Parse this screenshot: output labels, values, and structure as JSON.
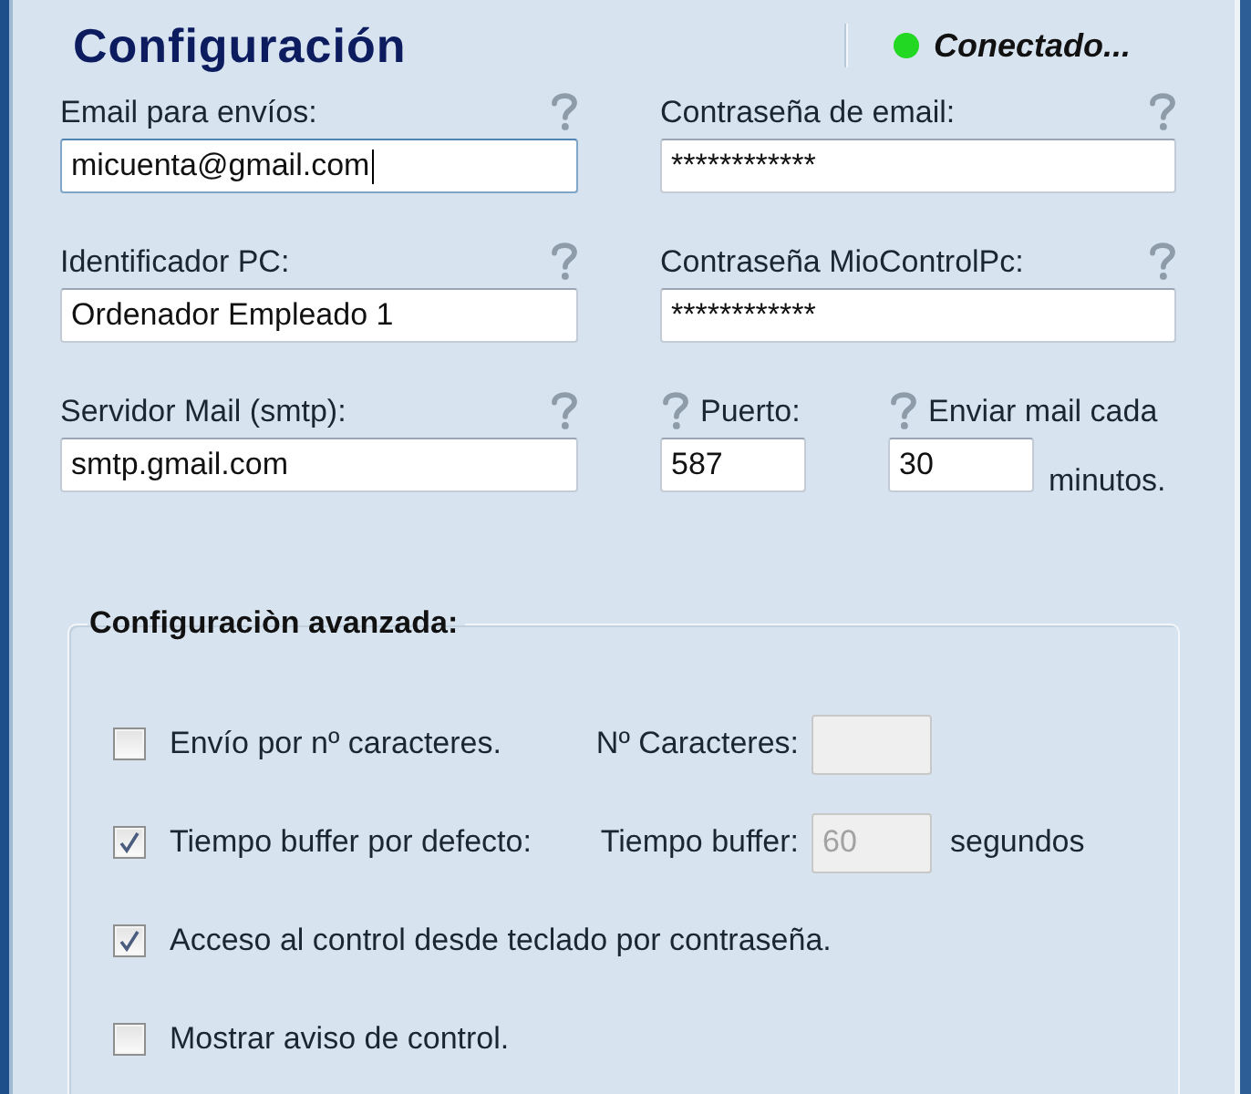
{
  "window": {
    "title": "Configuración"
  },
  "status": {
    "text": "Conectado...",
    "connected": true
  },
  "fields": [
    {
      "kind": "wide",
      "label": "Email para envíos:",
      "value": "micuenta@gmail.com",
      "focused": true
    },
    {
      "kind": "wide",
      "label": "Contraseña de email:",
      "value": "************",
      "focused": false
    },
    {
      "kind": "wide",
      "label": "Identificador PC:",
      "value": "Ordenador Empleado 1",
      "focused": false
    },
    {
      "kind": "wide",
      "label": "Contraseña MioControlPc:",
      "value": "************",
      "focused": false
    },
    {
      "kind": "wide",
      "label": "Servidor Mail (smtp):",
      "value": "smtp.gmail.com",
      "focused": false
    },
    {
      "kind": "short",
      "label": "Puerto:",
      "value": "587",
      "focused": false
    },
    {
      "kind": "short",
      "label": "Enviar mail cada",
      "value": "30",
      "unit": "minutos.",
      "focused": false
    }
  ],
  "advanced": {
    "title": "Configuraciòn avanzada:",
    "options": [
      {
        "label": "Envío por nº caracteres.",
        "checked": false,
        "setting": {
          "label": "Nº Caracteres:",
          "disabled": true
        }
      },
      {
        "label": "Tiempo buffer por defecto:",
        "checked": true,
        "setting": {
          "label": "Tiempo buffer:",
          "value": "60",
          "unit": "segundos",
          "disabled": true
        }
      },
      {
        "label": "Acceso al control desde teclado por contraseña.",
        "checked": true
      },
      {
        "label": "Mostrar aviso de control.",
        "checked": false
      }
    ]
  }
}
